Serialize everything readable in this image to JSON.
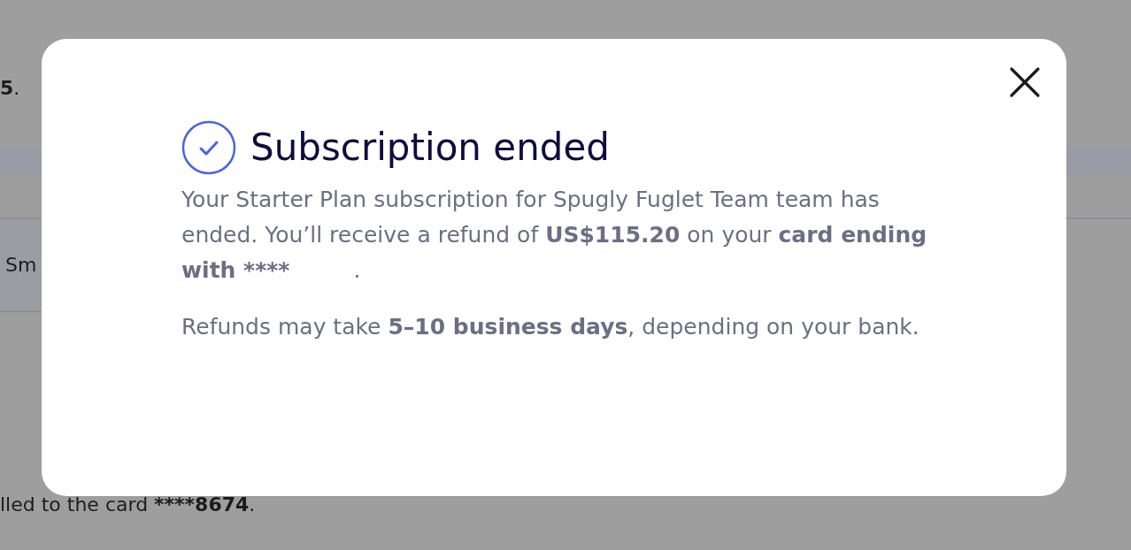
{
  "background": {
    "line_fragments": [
      {
        "text": "5",
        "bold": true
      },
      {
        "text": ".",
        "bold": false
      }
    ],
    "table_cell_fragment": "Sm",
    "billing_line": [
      {
        "text": "lled to the card ",
        "bold": false
      },
      {
        "text": "****8674",
        "bold": true
      },
      {
        "text": ".",
        "bold": false
      }
    ]
  },
  "dialog": {
    "title": "Subscription ended",
    "paragraphs": [
      [
        {
          "text": "Your Starter Plan subscription for Spugly Fuglet Team team has ended. You’ll receive a refund of ",
          "bold": false
        },
        {
          "text": "US$115.20",
          "bold": true
        },
        {
          "text": " on your ",
          "bold": false
        },
        {
          "text": "card ending with ****",
          "bold": true
        },
        {
          "text": ".",
          "bold": false,
          "gap": true
        }
      ],
      [
        {
          "text": "Refunds may take ",
          "bold": false
        },
        {
          "text": "5–10 business days",
          "bold": true
        },
        {
          "text": ", depending on your bank.",
          "bold": false
        }
      ]
    ]
  }
}
